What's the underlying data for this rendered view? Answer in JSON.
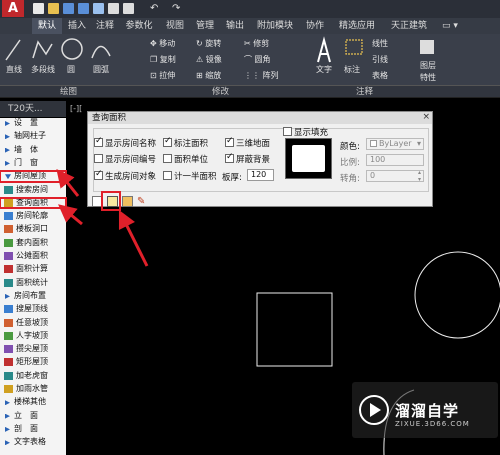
{
  "titlebar": {
    "app_letter": "A"
  },
  "tabs": [
    "默认",
    "插入",
    "注释",
    "参数化",
    "视图",
    "管理",
    "输出",
    "附加模块",
    "协作",
    "精选应用",
    "天正建筑"
  ],
  "ribbon": {
    "draw": [
      "直线",
      "多段线",
      "圆",
      "圆弧"
    ],
    "modify": [
      "移动",
      "旋转",
      "修剪",
      "复制",
      "镜像",
      "圆角",
      "拉伸",
      "缩放",
      "阵列"
    ],
    "annotation": [
      "文字",
      "标注",
      "线性",
      "引线",
      "表格"
    ],
    "layers": [
      "图层",
      "特性"
    ],
    "panel_titles": [
      "绘图",
      "修改",
      "注释"
    ]
  },
  "palette": {
    "title": "T20天...",
    "items": [
      {
        "label": "设　置",
        "type": "cat"
      },
      {
        "label": "轴网柱子",
        "type": "cat"
      },
      {
        "label": "墙　体",
        "type": "cat"
      },
      {
        "label": "门　窗",
        "type": "cat"
      },
      {
        "label": "房间屋顶",
        "type": "open"
      },
      {
        "label": "搜索房间",
        "type": "cmd"
      },
      {
        "label": "查询面积",
        "type": "cmd"
      },
      {
        "label": "房间轮廓",
        "type": "cmd"
      },
      {
        "label": "楼板洞口",
        "type": "cmd"
      },
      {
        "label": "套内面积",
        "type": "cmd"
      },
      {
        "label": "公摊面积",
        "type": "cmd"
      },
      {
        "label": "面积计算",
        "type": "cmd"
      },
      {
        "label": "面积统计",
        "type": "cmd"
      },
      {
        "label": "房间布置",
        "type": "cat"
      },
      {
        "label": "搜屋顶线",
        "type": "cmd"
      },
      {
        "label": "任意坡顶",
        "type": "cmd"
      },
      {
        "label": "人字坡顶",
        "type": "cmd"
      },
      {
        "label": "攒尖屋顶",
        "type": "cmd"
      },
      {
        "label": "矩形屋顶",
        "type": "cmd"
      },
      {
        "label": "加老虎窗",
        "type": "cmd"
      },
      {
        "label": "加雨水管",
        "type": "cmd"
      },
      {
        "label": "楼梯其他",
        "type": "cat"
      },
      {
        "label": "立　面",
        "type": "cat"
      },
      {
        "label": "剖　面",
        "type": "cat"
      },
      {
        "label": "文字表格",
        "type": "cat"
      }
    ]
  },
  "canvas_label": "[-][",
  "dialog": {
    "title": "查询面积",
    "close": "×",
    "checkboxes": {
      "show_room_name": {
        "label": "显示房间名称",
        "checked": true
      },
      "show_room_number": {
        "label": "显示房间编号",
        "checked": false
      },
      "generate_room_object": {
        "label": "生成房间对象",
        "checked": true
      },
      "mark_area": {
        "label": "标注面积",
        "checked": true
      },
      "area_unit": {
        "label": "面积单位",
        "checked": false
      },
      "half_area": {
        "label": "计一半面积",
        "checked": false
      },
      "ground_3d": {
        "label": "三维地面",
        "checked": true
      },
      "shield_bg": {
        "label": "屏蔽背景",
        "checked": true
      },
      "show_fill": {
        "label": "显示填充",
        "checked": false
      }
    },
    "slab_thickness_label": "板厚:",
    "slab_thickness": "120",
    "color_label": "颜色:",
    "color_value": "ByLayer",
    "scale_label": "比例:",
    "scale_value": "100",
    "angle_label": "转角:",
    "angle_value": "0"
  },
  "watermark": {
    "name": "溜溜自学",
    "site": "ZIXUE.3D66.COM"
  },
  "colors": {
    "highlight": "#e0202a",
    "accent": "#2b63b5"
  }
}
